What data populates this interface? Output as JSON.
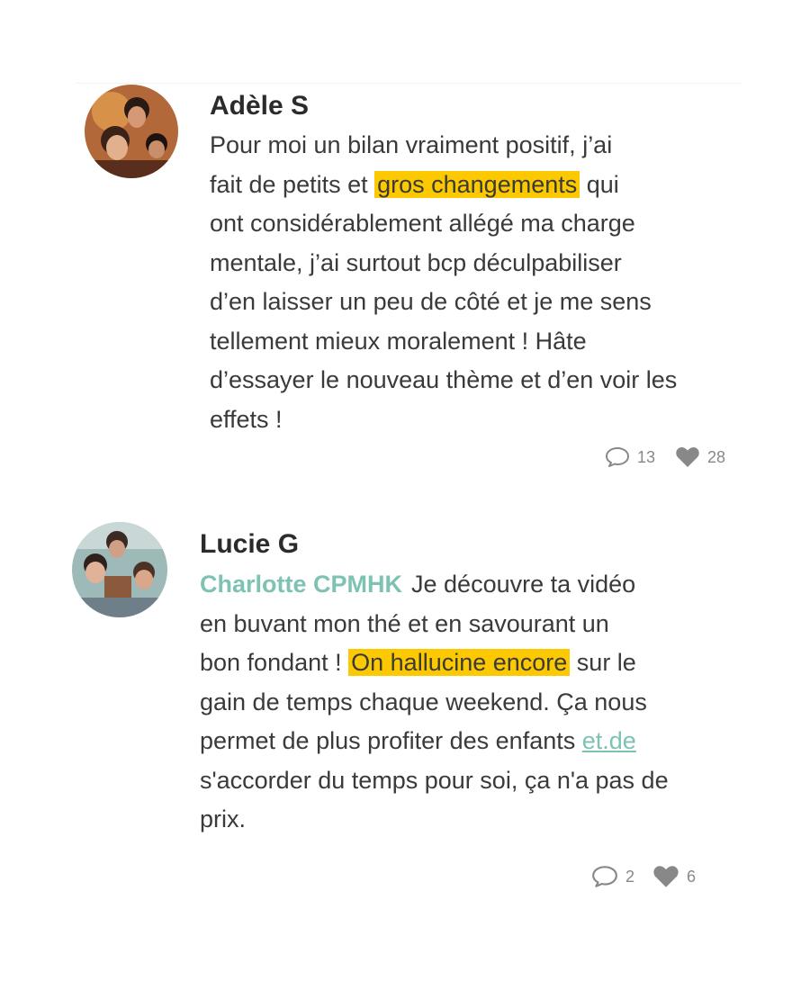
{
  "comments": [
    {
      "author": "Adèle S",
      "lines": [
        {
          "parts": [
            "Pour moi un bilan vraiment positif, j’ai"
          ]
        },
        {
          "parts": [
            "fait de petits et ",
            "gros changements",
            " qui"
          ]
        },
        {
          "parts": [
            "ont considérablement allégé ma charge"
          ]
        },
        {
          "parts": [
            "mentale, j’ai surtout bcp déculpabiliser"
          ]
        },
        {
          "parts": [
            "d’en laisser un peu de côté et je me sens"
          ]
        },
        {
          "parts": [
            "tellement mieux moralement ! Hâte"
          ]
        },
        {
          "parts": [
            "d’essayer le nouveau thème et d’en voir les"
          ]
        },
        {
          "parts": [
            "effets !"
          ]
        }
      ],
      "replies_count": "13",
      "likes_count": "28"
    },
    {
      "author": "Lucie G",
      "mention": "Charlotte CPMHK",
      "lines": [
        {
          "parts": [
            "Je découvre ta vidéo"
          ]
        },
        {
          "parts": [
            "en buvant mon thé et en savourant un"
          ]
        },
        {
          "parts": [
            "bon fondant ! ",
            "On hallucine encore",
            " sur le"
          ]
        },
        {
          "parts": [
            "gain de temps chaque weekend. Ça nous"
          ]
        },
        {
          "parts": [
            "permet de plus profiter des enfants ",
            "et.de"
          ]
        },
        {
          "parts": [
            "s'accorder du temps pour soi, ça n'a pas de"
          ]
        },
        {
          "parts": [
            "prix."
          ]
        }
      ],
      "replies_count": "2",
      "likes_count": "6"
    }
  ],
  "icons": {
    "reply": "speech-bubble-icon",
    "like": "heart-icon"
  },
  "colors": {
    "highlight": "#fcc800",
    "mention": "#7ec2b4",
    "meta": "#888888"
  }
}
